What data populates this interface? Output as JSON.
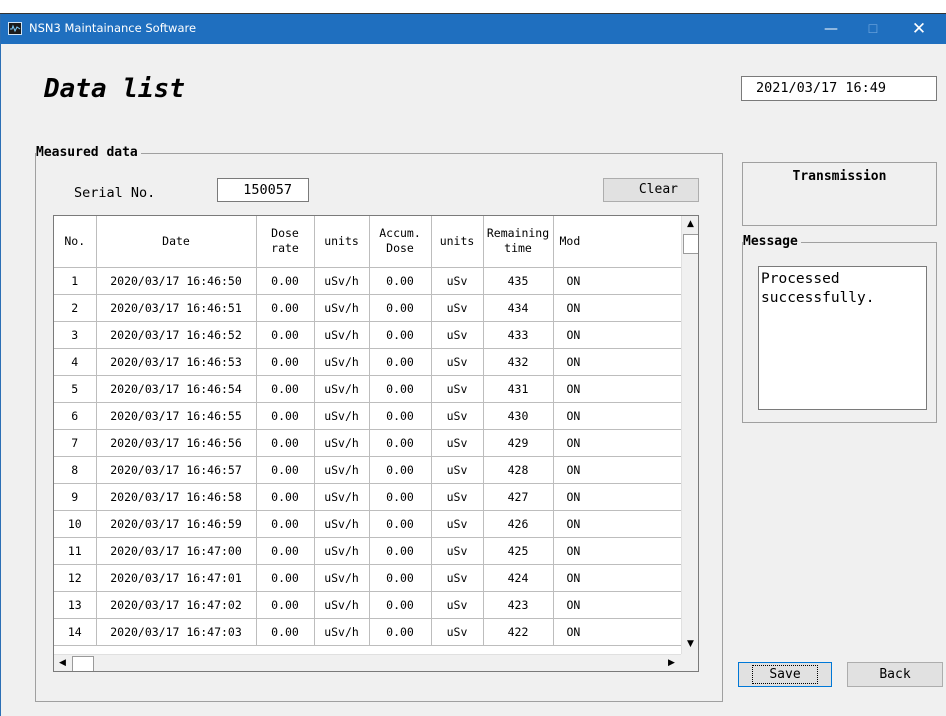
{
  "window": {
    "title": "NSN3 Maintainance Software",
    "minimize_glyph": "—",
    "maximize_glyph": "☐",
    "close_glyph": "✕"
  },
  "page": {
    "title": "Data list",
    "datetime": "2021/03/17 16:49"
  },
  "measured": {
    "group_label": "Measured data",
    "serial_label": "Serial No.",
    "serial_value": "150057",
    "clear_label": "Clear",
    "columns": [
      {
        "line1": "No.",
        "line2": ""
      },
      {
        "line1": "Date",
        "line2": ""
      },
      {
        "line1": "Dose",
        "line2": "rate"
      },
      {
        "line1": "units",
        "line2": ""
      },
      {
        "line1": "Accum.",
        "line2": "Dose"
      },
      {
        "line1": "units",
        "line2": ""
      },
      {
        "line1": "Remaining",
        "line2": "time"
      },
      {
        "line1": "Mod",
        "line2": ""
      }
    ],
    "rows": [
      [
        "1",
        "2020/03/17 16:46:50",
        "0.00",
        "uSv/h",
        "0.00",
        "uSv",
        "435",
        "ON"
      ],
      [
        "2",
        "2020/03/17 16:46:51",
        "0.00",
        "uSv/h",
        "0.00",
        "uSv",
        "434",
        "ON"
      ],
      [
        "3",
        "2020/03/17 16:46:52",
        "0.00",
        "uSv/h",
        "0.00",
        "uSv",
        "433",
        "ON"
      ],
      [
        "4",
        "2020/03/17 16:46:53",
        "0.00",
        "uSv/h",
        "0.00",
        "uSv",
        "432",
        "ON"
      ],
      [
        "5",
        "2020/03/17 16:46:54",
        "0.00",
        "uSv/h",
        "0.00",
        "uSv",
        "431",
        "ON"
      ],
      [
        "6",
        "2020/03/17 16:46:55",
        "0.00",
        "uSv/h",
        "0.00",
        "uSv",
        "430",
        "ON"
      ],
      [
        "7",
        "2020/03/17 16:46:56",
        "0.00",
        "uSv/h",
        "0.00",
        "uSv",
        "429",
        "ON"
      ],
      [
        "8",
        "2020/03/17 16:46:57",
        "0.00",
        "uSv/h",
        "0.00",
        "uSv",
        "428",
        "ON"
      ],
      [
        "9",
        "2020/03/17 16:46:58",
        "0.00",
        "uSv/h",
        "0.00",
        "uSv",
        "427",
        "ON"
      ],
      [
        "10",
        "2020/03/17 16:46:59",
        "0.00",
        "uSv/h",
        "0.00",
        "uSv",
        "426",
        "ON"
      ],
      [
        "11",
        "2020/03/17 16:47:00",
        "0.00",
        "uSv/h",
        "0.00",
        "uSv",
        "425",
        "ON"
      ],
      [
        "12",
        "2020/03/17 16:47:01",
        "0.00",
        "uSv/h",
        "0.00",
        "uSv",
        "424",
        "ON"
      ],
      [
        "13",
        "2020/03/17 16:47:02",
        "0.00",
        "uSv/h",
        "0.00",
        "uSv",
        "423",
        "ON"
      ],
      [
        "14",
        "2020/03/17 16:47:03",
        "0.00",
        "uSv/h",
        "0.00",
        "uSv",
        "422",
        "ON"
      ]
    ]
  },
  "transmission": {
    "label": "Transmission"
  },
  "message": {
    "group_label": "Message",
    "text": "Processed\nsuccessfully."
  },
  "buttons": {
    "save_label": "Save",
    "back_label": "Back"
  },
  "colors": {
    "titlebar": "#1f6fbf",
    "window_bg": "#f0f0f0",
    "focus_border": "#0078d7"
  },
  "icons": {
    "app": "waveform-monitor-icon",
    "scroll_up": "▲",
    "scroll_down": "▼",
    "scroll_left": "◀",
    "scroll_right": "▶"
  }
}
